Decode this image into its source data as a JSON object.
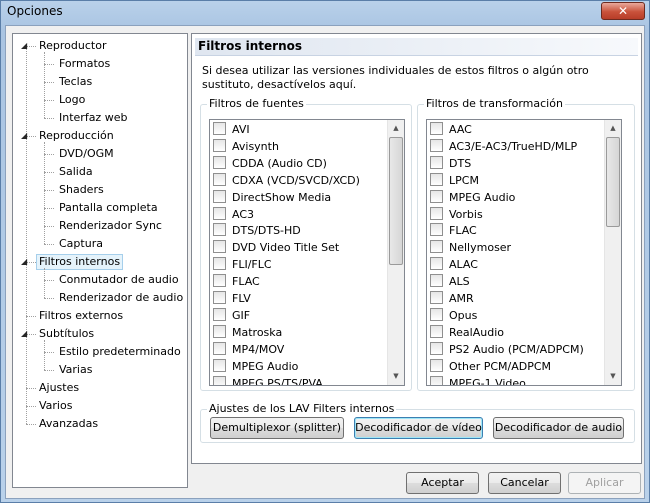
{
  "window": {
    "title": "Opciones",
    "close_glyph": "✕"
  },
  "tree": {
    "items": [
      {
        "label": "Reproductor",
        "level": 0,
        "expanded": true
      },
      {
        "label": "Formatos",
        "level": 1
      },
      {
        "label": "Teclas",
        "level": 1
      },
      {
        "label": "Logo",
        "level": 1
      },
      {
        "label": "Interfaz web",
        "level": 1
      },
      {
        "label": "Reproducción",
        "level": 0,
        "expanded": true
      },
      {
        "label": "DVD/OGM",
        "level": 1
      },
      {
        "label": "Salida",
        "level": 1
      },
      {
        "label": "Shaders",
        "level": 1
      },
      {
        "label": "Pantalla completa",
        "level": 1
      },
      {
        "label": "Renderizador Sync",
        "level": 1
      },
      {
        "label": "Captura",
        "level": 1
      },
      {
        "label": "Filtros internos",
        "level": 0,
        "expanded": true,
        "selected": true
      },
      {
        "label": "Conmutador de audio",
        "level": 1
      },
      {
        "label": "Renderizador de audio",
        "level": 1
      },
      {
        "label": "Filtros externos",
        "level": 0
      },
      {
        "label": "Subtítulos",
        "level": 0,
        "expanded": true
      },
      {
        "label": "Estilo predeterminado",
        "level": 1
      },
      {
        "label": "Varias",
        "level": 1
      },
      {
        "label": "Ajustes",
        "level": 0
      },
      {
        "label": "Varios",
        "level": 0
      },
      {
        "label": "Avanzadas",
        "level": 0
      }
    ]
  },
  "panel": {
    "title": "Filtros internos",
    "description": "Si desea utilizar las versiones individuales de estos filtros o algún otro sustituto, desactívelos aquí."
  },
  "source_filters": {
    "legend": "Filtros de fuentes",
    "items": [
      "AVI",
      "Avisynth",
      "CDDA (Audio CD)",
      "CDXA (VCD/SVCD/XCD)",
      "DirectShow Media",
      "AC3",
      "DTS/DTS-HD",
      "DVD Video Title Set",
      "FLI/FLC",
      "FLAC",
      "FLV",
      "GIF",
      "Matroska",
      "MP4/MOV",
      "MPEG Audio",
      "MPEG PS/TS/PVA"
    ]
  },
  "transform_filters": {
    "legend": "Filtros de transformación",
    "items": [
      "AAC",
      "AC3/E-AC3/TrueHD/MLP",
      "DTS",
      "LPCM",
      "MPEG Audio",
      "Vorbis",
      "FLAC",
      "Nellymoser",
      "ALAC",
      "ALS",
      "AMR",
      "Opus",
      "RealAudio",
      "PS2 Audio (PCM/ADPCM)",
      "Other PCM/ADPCM",
      "MPEG-1 Video"
    ]
  },
  "lav": {
    "legend": "Ajustes de los LAV Filters internos",
    "splitter_label": "Demultiplexor (splitter)",
    "video_label": "Decodificador de vídeo",
    "audio_label": "Decodificador de audio"
  },
  "footer": {
    "accept_label": "Aceptar",
    "cancel_label": "Cancelar",
    "apply_label": "Aplicar"
  },
  "icons": {
    "expander": "expanded-triangle-icon",
    "scroll_up": "scroll-up-arrow-icon",
    "scroll_down": "scroll-down-arrow-icon"
  },
  "colors": {
    "titlebar": "#b9d1ea",
    "close_button": "#c9523b",
    "selected_tree": "#e5f3fb",
    "focused_button_border": "#3c7fb1"
  }
}
